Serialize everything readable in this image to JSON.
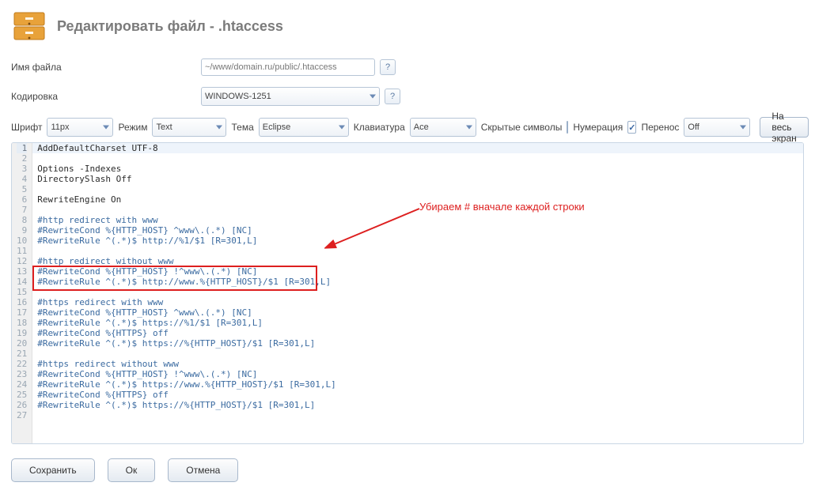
{
  "title": "Редактировать файл - .htaccess",
  "form": {
    "filename_label": "Имя файла",
    "filename_value": "~/www/domain.ru/public/.htaccess",
    "encoding_label": "Кодировка",
    "encoding_value": "WINDOWS-1251",
    "help": "?"
  },
  "toolbar": {
    "font_label": "Шрифт",
    "font_value": "11px",
    "mode_label": "Режим",
    "mode_value": "Text",
    "theme_label": "Тема",
    "theme_value": "Eclipse",
    "keyboard_label": "Клавиатура",
    "keyboard_value": "Ace",
    "hidden_label": "Скрытые символы",
    "numbering_label": "Нумерация",
    "wrap_label": "Перенос",
    "wrap_value": "Off",
    "fullscreen_label": "На весь экран"
  },
  "code": {
    "lines": [
      "AddDefaultCharset UTF-8",
      "",
      "Options -Indexes",
      "DirectorySlash Off",
      "",
      "RewriteEngine On",
      "",
      "#http redirect with www",
      "#RewriteCond %{HTTP_HOST} ^www\\.(.*) [NC]",
      "#RewriteRule ^(.*)$ http://%1/$1 [R=301,L]",
      "",
      "#http redirect without www",
      "#RewriteCond %{HTTP_HOST} !^www\\.(.*) [NC]",
      "#RewriteRule ^(.*)$ http://www.%{HTTP_HOST}/$1 [R=301,L]",
      "",
      "#https redirect with www",
      "#RewriteCond %{HTTP_HOST} ^www\\.(.*) [NC]",
      "#RewriteRule ^(.*)$ https://%1/$1 [R=301,L]",
      "#RewriteCond %{HTTPS} off",
      "#RewriteRule ^(.*)$ https://%{HTTP_HOST}/$1 [R=301,L]",
      "",
      "#https redirect without www",
      "#RewriteCond %{HTTP_HOST} !^www\\.(.*) [NC]",
      "#RewriteRule ^(.*)$ https://www.%{HTTP_HOST}/$1 [R=301,L]",
      "#RewriteCond %{HTTPS} off",
      "#RewriteRule ^(.*)$ https://%{HTTP_HOST}/$1 [R=301,L]",
      ""
    ],
    "comment_lines": [
      8,
      9,
      10,
      12,
      13,
      14,
      16,
      17,
      18,
      19,
      20,
      22,
      23,
      24,
      25,
      26
    ],
    "current_line": 1
  },
  "annotation": {
    "text": "Убираем # вначале каждой строки"
  },
  "footer": {
    "save": "Сохранить",
    "ok": "Ок",
    "cancel": "Отмена"
  }
}
